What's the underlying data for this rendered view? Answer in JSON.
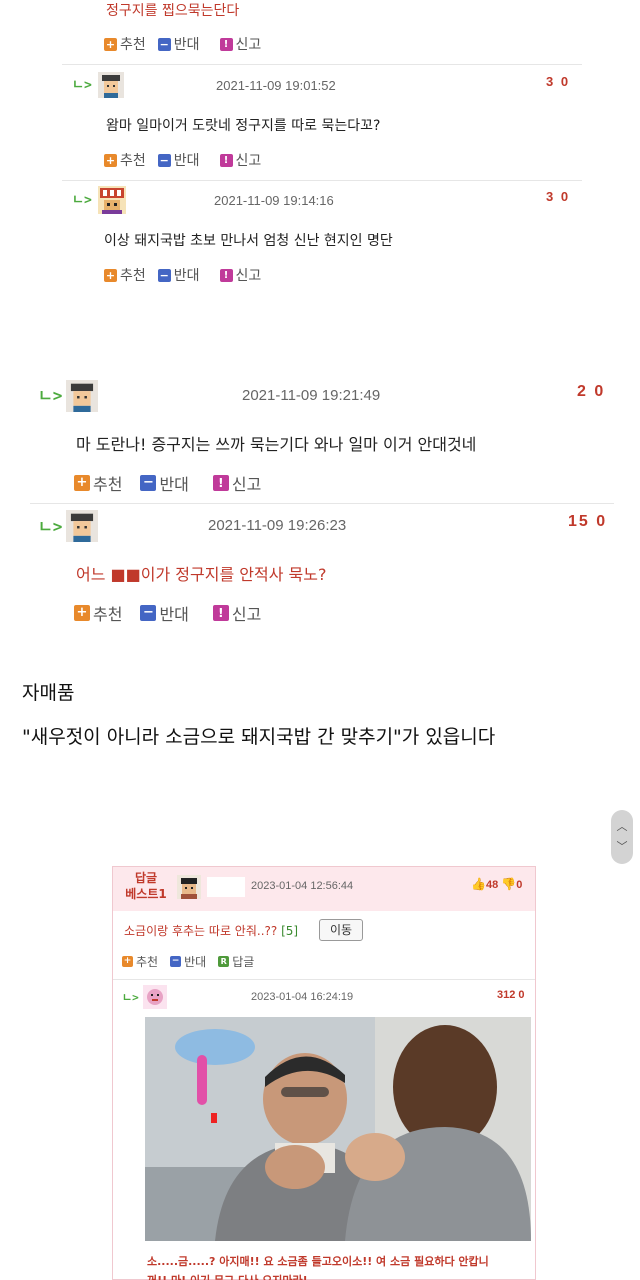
{
  "section1": {
    "top_comment_text": "정구지를 찝으묵는단다",
    "top_actions": {
      "recommend": "추천",
      "oppose": "반대",
      "report": "신고"
    },
    "comments": [
      {
        "timestamp": "2021-11-09 19:01:52",
        "votes": "3 0",
        "text": "왐마 일마이거 도랏네 정구지를 따로 묵는다꼬?",
        "actions": {
          "recommend": "추천",
          "oppose": "반대",
          "report": "신고"
        }
      },
      {
        "timestamp": "2021-11-09 19:14:16",
        "votes": "3 0",
        "text": "이상 돼지국밥 초보 만나서 엄청 신난 현지인 명단",
        "actions": {
          "recommend": "추천",
          "oppose": "반대",
          "report": "신고"
        }
      }
    ]
  },
  "section2": {
    "comments": [
      {
        "timestamp": "2021-11-09 19:21:49",
        "votes": "2 0",
        "text": "마 도란나! 증구지는 쓰까 묵는기다 와나 일마 이거 안대것네",
        "actions": {
          "recommend": "추천",
          "oppose": "반대",
          "report": "신고"
        }
      },
      {
        "timestamp": "2021-11-09 19:26:23",
        "votes": "15 0",
        "text": "어느 ■■이가 정구지를 안적사 묵노?",
        "actions": {
          "recommend": "추천",
          "oppose": "반대",
          "report": "신고"
        }
      }
    ],
    "caption_title": "자매품",
    "caption_body": "\"새우젓이 아니라 소금으로 돼지국밥 간 맞추기\"가 있읍니다"
  },
  "section3": {
    "best_label_line1": "답글",
    "best_label_line2": "베스트1",
    "best_timestamp": "2023-01-04 12:56:44",
    "best_likes": "48",
    "best_dislikes": "0",
    "post_title": "소금이랑 후추는 따로 안줘..??",
    "post_count": "[5]",
    "move_button": "이동",
    "actions": {
      "recommend": "추천",
      "oppose": "반대",
      "reply": "답글"
    },
    "reply_timestamp": "2023-01-04 16:24:19",
    "reply_votes": "312 0",
    "reply_text_line1": "소.....금.....? 아지매!! 요 소금좀 들고오이소!! 여 소금 필요하다 안캅니",
    "reply_text_line2": "꺼!! 마! 이기 무그 다사 오지마라!"
  },
  "icons": {
    "reply_arrow": "ㄴ>",
    "recommend_icon": "+",
    "oppose_icon": "−",
    "report_icon": "!",
    "reply_icon": "R",
    "scroll_up": "︿",
    "scroll_down": "﹀"
  },
  "colors": {
    "accent_red": "#c0392b",
    "reply_green": "#4caa3e",
    "best_bg": "#fde8ec"
  }
}
